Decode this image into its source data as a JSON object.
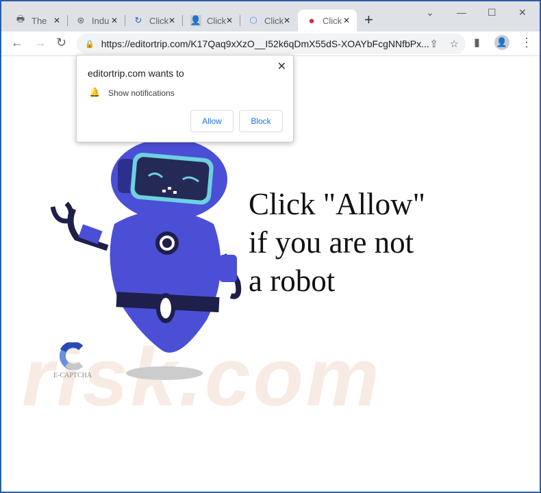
{
  "tabs": [
    {
      "label": "The",
      "icon": "printer-icon"
    },
    {
      "label": "Indu",
      "icon": "film-reel-icon"
    },
    {
      "label": "Click",
      "icon": "captcha-icon"
    },
    {
      "label": "Click",
      "icon": "person-icon"
    },
    {
      "label": "Click",
      "icon": "hexagon-icon"
    },
    {
      "label": "Click",
      "icon": "red-circle-icon",
      "active": true
    }
  ],
  "address": {
    "url": "https://editortrip.com/K17Qaq9xXzO__I52k6qDmX55dS-XOAYbFcgNNfbPx..."
  },
  "popup": {
    "title": "editortrip.com wants to",
    "permission": "Show notifications",
    "allow": "Allow",
    "block": "Block"
  },
  "page": {
    "line1": "Click \"Allow\"",
    "line2": "if you are not",
    "line3": "a robot",
    "captcha_label": "E-CAPTCHA",
    "watermark": "risk.com"
  },
  "colors": {
    "robot": "#4a4fd6",
    "frame": "#2b5da8"
  }
}
